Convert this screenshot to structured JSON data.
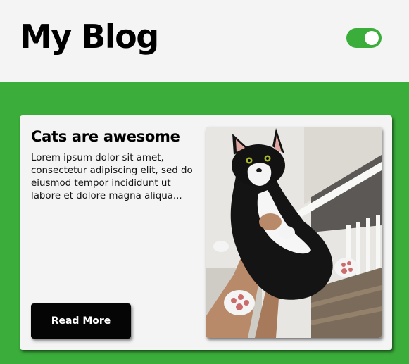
{
  "header": {
    "title": "My Blog",
    "theme_toggle": {
      "state": "on"
    }
  },
  "post": {
    "title": "Cats are awesome",
    "excerpt": "Lorem ipsum dolor sit amet, consectetur adipiscing elit, sed do eiusmod tempor incididunt ut labore et dolore magna aliqua...",
    "read_more_label": "Read More",
    "image_icon": "cat-photo"
  },
  "colors": {
    "accent": "#3aad3a",
    "background": "#f4f4f4",
    "button": "#050505"
  }
}
